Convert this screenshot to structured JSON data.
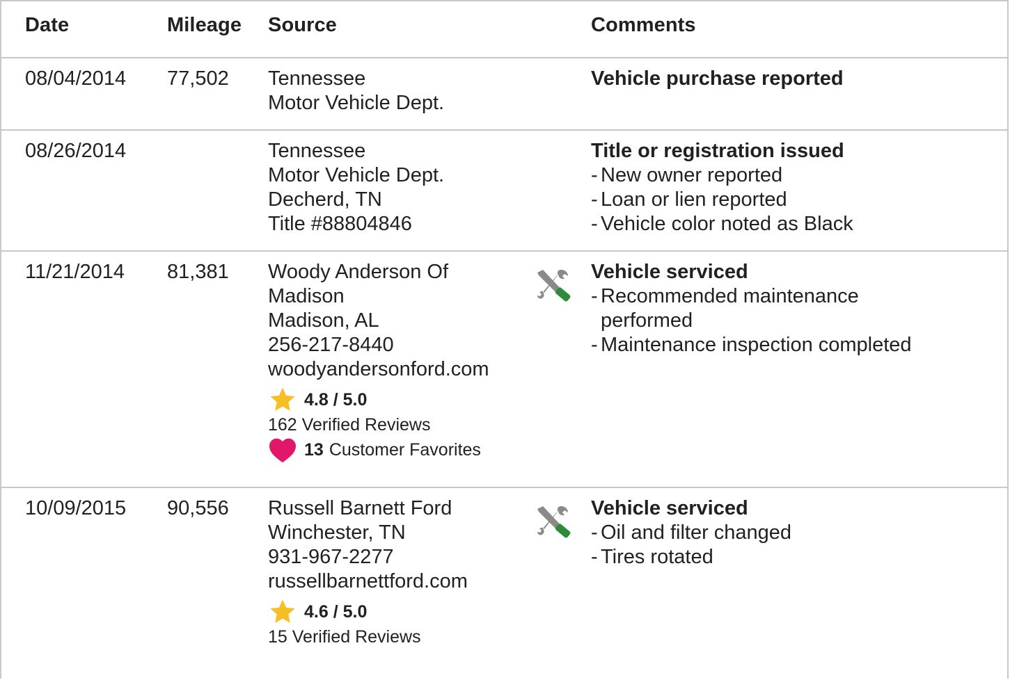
{
  "header": {
    "date": "Date",
    "mileage": "Mileage",
    "source": "Source",
    "comments": "Comments"
  },
  "rows": [
    {
      "date": "08/04/2014",
      "mileage": "77,502",
      "source": [
        "Tennessee",
        "Motor Vehicle Dept."
      ],
      "comment_title": "Vehicle purchase reported",
      "comment_items": []
    },
    {
      "date": "08/26/2014",
      "mileage": "",
      "source": [
        "Tennessee",
        "Motor Vehicle Dept.",
        "Decherd, TN",
        "Title #88804846"
      ],
      "comment_title": "Title or registration issued",
      "comment_items": [
        "New owner reported",
        "Loan or lien reported",
        "Vehicle color noted as Black"
      ]
    },
    {
      "date": "11/21/2014",
      "mileage": "81,381",
      "source": [
        "Woody Anderson Of Madison",
        "Madison, AL",
        "256-217-8440",
        "woodyandersonford.com"
      ],
      "rating": "4.8 / 5.0",
      "reviews": "162 Verified Reviews",
      "favorites_count": "13",
      "favorites_label": "Customer Favorites",
      "icon": "service-tools-icon",
      "comment_title": "Vehicle serviced",
      "comment_items": [
        "Recommended maintenance performed",
        "Maintenance inspection completed"
      ]
    },
    {
      "date": "10/09/2015",
      "mileage": "90,556",
      "source": [
        "Russell Barnett Ford",
        "Winchester, TN",
        "931-967-2277",
        "russellbarnettford.com"
      ],
      "rating": "4.6 / 5.0",
      "reviews": "15 Verified Reviews",
      "icon": "service-tools-icon",
      "comment_title": "Vehicle serviced",
      "comment_items": [
        "Oil and filter changed",
        "Tires rotated"
      ]
    }
  ],
  "colors": {
    "border": "#c8c8c8",
    "text": "#212121",
    "star": "#f6bf26",
    "heart": "#e0176a",
    "wrench": "#8a8a8a",
    "screwdriver": "#2e8b3a"
  }
}
